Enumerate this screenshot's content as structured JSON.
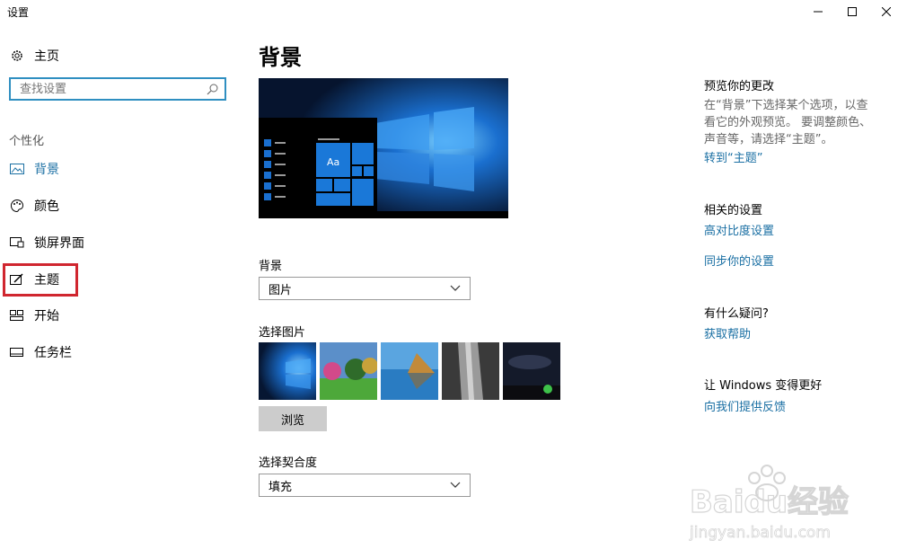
{
  "window": {
    "title": "设置"
  },
  "sidebar": {
    "home": "主页",
    "search_placeholder": "查找设置",
    "section": "个性化",
    "items": [
      {
        "label": "背景",
        "icon": "picture-icon",
        "active": true
      },
      {
        "label": "颜色",
        "icon": "palette-icon"
      },
      {
        "label": "锁屏界面",
        "icon": "lock-screen-icon"
      },
      {
        "label": "主题",
        "icon": "brush-icon"
      },
      {
        "label": "开始",
        "icon": "start-grid-icon"
      },
      {
        "label": "任务栏",
        "icon": "taskbar-icon"
      }
    ]
  },
  "main": {
    "title": "背景",
    "preview_tile_text": "Aa",
    "background_label": "背景",
    "background_value": "图片",
    "choose_picture_label": "选择图片",
    "browse_button": "浏览",
    "fit_label": "选择契合度",
    "fit_value": "填充"
  },
  "right": {
    "preview_heading": "预览你的更改",
    "preview_text": "在“背景”下选择某个选项，以查看它的外观预览。 要调整颜色、声音等，请选择“主题”。",
    "theme_link": "转到“主题”",
    "related_heading": "相关的设置",
    "contrast_link": "高对比度设置",
    "sync_link": "同步你的设置",
    "question_heading": "有什么疑问?",
    "help_link": "获取帮助",
    "improve_heading": "让 Windows 变得更好",
    "feedback_link": "向我们提供反馈"
  },
  "watermark": {
    "text": "Baidu经验",
    "url_text": "jingyan.baidu.com"
  },
  "colors": {
    "accent": "#1a6fa3",
    "highlight_box": "#d0262f",
    "search_border": "#2f8fc1"
  }
}
